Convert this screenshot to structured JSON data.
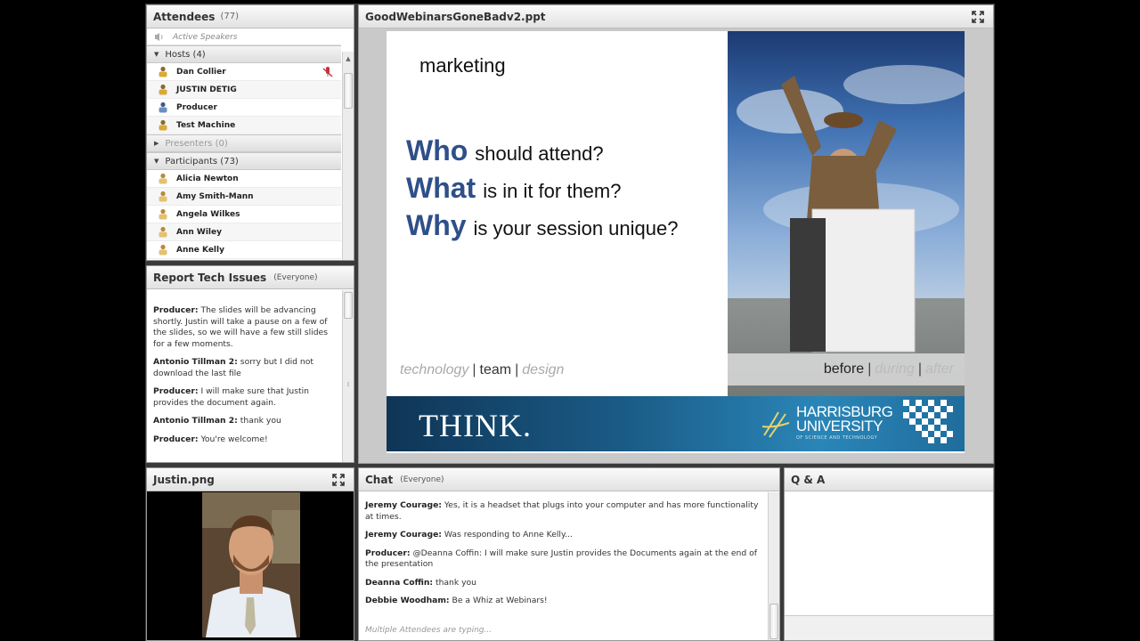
{
  "attendees": {
    "title": "Attendees",
    "count": "(77)",
    "active_speakers": "Active Speakers",
    "hosts_label": "Hosts (4)",
    "hosts": [
      "Dan Collier",
      "JUSTIN DETIG",
      "Producer",
      "Test Machine"
    ],
    "presenters_label": "Presenters (0)",
    "participants_label": "Participants (73)",
    "participants": [
      "Alicia Newton",
      "Amy Smith-Mann",
      "Angela Wilkes",
      "Ann Wiley",
      "Anne Kelly"
    ]
  },
  "tech": {
    "title": "Report Tech Issues",
    "audience": "(Everyone)",
    "messages": [
      {
        "sender": "Producer:",
        "text": " The slides will be advancing shortly. Justin will take a pause on a few of the slides, so we will have a few still slides for a few moments."
      },
      {
        "sender": "Antonio Tillman 2:",
        "text": " sorry but I did not download the last file"
      },
      {
        "sender": "Producer:",
        "text": " I will make sure that Justin provides the document again."
      },
      {
        "sender": "Antonio Tillman 2:",
        "text": " thank you"
      },
      {
        "sender": "Producer:",
        "text": " You're welcome!"
      }
    ]
  },
  "share": {
    "title": "GoodWebinarsGoneBadv2.ppt",
    "slide": {
      "heading": "marketing",
      "q1_big": "Who",
      "q1_rest": "should attend?",
      "q2_big": "What",
      "q2_rest": "is in it for them?",
      "q3_big": "Why",
      "q3_rest": "is your session unique?",
      "tag_technology": "technology",
      "tag_sep": "|",
      "tag_team": "team",
      "tag_design": "design",
      "strip_before": "before",
      "strip_during": "during",
      "strip_after": "after",
      "banner_think": "THINK.",
      "banner_uni_1": "HARRISBURG",
      "banner_uni_2": "UNIVERSITY",
      "banner_uni_sub": "OF SCIENCE AND TECHNOLOGY"
    }
  },
  "camera": {
    "title": "Justin.png"
  },
  "chat": {
    "title": "Chat",
    "audience": "(Everyone)",
    "messages": [
      {
        "sender": "Jeremy Courage:",
        "text": " Yes, it is a headset that plugs into your computer and has more functionality at times."
      },
      {
        "sender": "Jeremy Courage:",
        "text": " Was responding to Anne Kelly..."
      },
      {
        "sender": "Producer:",
        "text": " @Deanna Coffin: I will make sure Justin provides the Documents again at the end of the presentation"
      },
      {
        "sender": "Deanna Coffin:",
        "text": " thank you"
      },
      {
        "sender": "Debbie Woodham:",
        "text": " Be a Whiz at Webinars!"
      }
    ],
    "typing": "Multiple Attendees are typing..."
  },
  "qa": {
    "title": "Q & A"
  },
  "colors": {
    "slide_blue": "#2f4f8a",
    "banner": "#1a5a85",
    "stage": "#3a3a3a"
  }
}
